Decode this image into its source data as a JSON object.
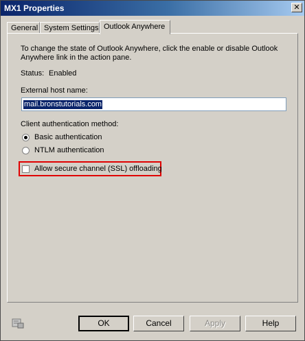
{
  "window": {
    "title": "MX1 Properties",
    "close_glyph": "✕"
  },
  "tabs": [
    {
      "label": "General"
    },
    {
      "label": "System Settings"
    },
    {
      "label": "Outlook Anywhere"
    }
  ],
  "content": {
    "description": "To change the state of Outlook Anywhere, click the enable or disable Outlook Anywhere link in the action pane.",
    "status_label": "Status:",
    "status_value": "Enabled",
    "external_host_label": "External host name:",
    "external_host_value": "mail.bronstutorials.com",
    "auth_label": "Client authentication method:",
    "auth_options": [
      {
        "label": "Basic authentication",
        "selected": true
      },
      {
        "label": "NTLM authentication",
        "selected": false
      }
    ],
    "ssl_offloading_label": "Allow secure channel (SSL) offloading",
    "ssl_offloading_checked": false,
    "highlight_color": "#e00000"
  },
  "buttons": {
    "ok": "OK",
    "cancel": "Cancel",
    "apply": "Apply",
    "help": "Help"
  },
  "icons": {
    "footer_icon": "properties-help-icon"
  }
}
